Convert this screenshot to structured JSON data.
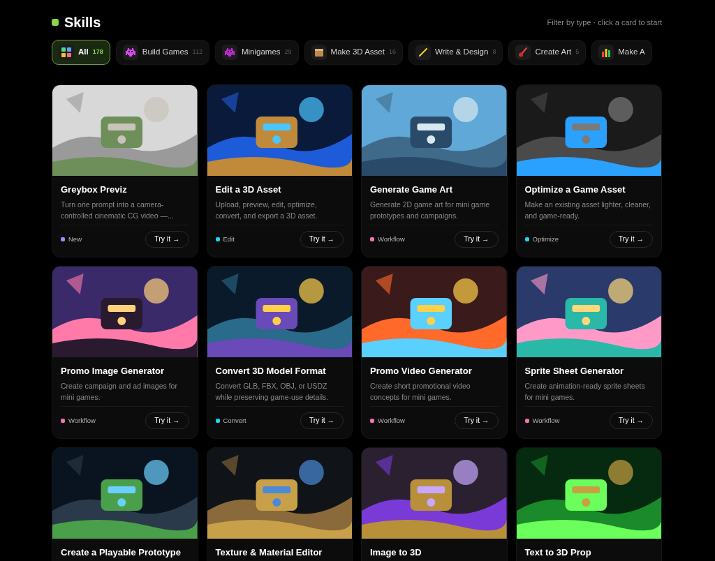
{
  "header": {
    "title": "Skills",
    "hint": "Filter by type · click a card to start"
  },
  "tabs": [
    {
      "label": "All",
      "count": "178",
      "selected": true
    },
    {
      "label": "Build Games",
      "count": "112",
      "selected": false
    },
    {
      "label": "Minigames",
      "count": "29",
      "selected": false
    },
    {
      "label": "Make 3D Asset",
      "count": "16",
      "selected": false
    },
    {
      "label": "Write & Design",
      "count": "8",
      "selected": false
    },
    {
      "label": "Create Art",
      "count": "5",
      "selected": false
    },
    {
      "label": "Make A",
      "selected": false
    }
  ],
  "cards": [
    {
      "title": "Greybox Previz",
      "description": "Turn one prompt into a camera-controlled cinematic CG video —...",
      "tag": "New",
      "color": "#a78bfa",
      "button": "Try it →"
    },
    {
      "title": "Edit a 3D Asset",
      "description": "Upload, preview, edit, optimize, convert, and export a 3D asset.",
      "tag": "Edit",
      "color": "#22d3ee",
      "button": "Try it →"
    },
    {
      "title": "Generate Game Art",
      "description": "Generate 2D game art for mini game prototypes and campaigns.",
      "tag": "Workflow",
      "color": "#f472b6",
      "button": "Try it →"
    },
    {
      "title": "Optimize a Game Asset",
      "description": "Make an existing asset lighter, cleaner, and game-ready.",
      "tag": "Optimize",
      "color": "#22d3ee",
      "button": "Try it →"
    },
    {
      "title": "Promo Image Generator",
      "description": "Create campaign and ad images for mini games.",
      "tag": "Workflow",
      "color": "#f472b6",
      "button": "Try it →"
    },
    {
      "title": "Convert 3D Model Format",
      "description": "Convert GLB, FBX, OBJ, or USDZ while preserving game-use details.",
      "tag": "Convert",
      "color": "#22d3ee",
      "button": "Try it →"
    },
    {
      "title": "Promo Video Generator",
      "description": "Create short promotional video concepts for mini games.",
      "tag": "Workflow",
      "color": "#f472b6",
      "button": "Try it →"
    },
    {
      "title": "Sprite Sheet Generator",
      "description": "Create animation-ready sprite sheets for mini games.",
      "tag": "Workflow",
      "color": "#f472b6",
      "button": "Try it →"
    },
    {
      "title": "Create a Playable Prototype"
    },
    {
      "title": "Texture & Material Editor"
    },
    {
      "title": "Image to 3D"
    },
    {
      "title": "Text to 3D Prop"
    }
  ]
}
